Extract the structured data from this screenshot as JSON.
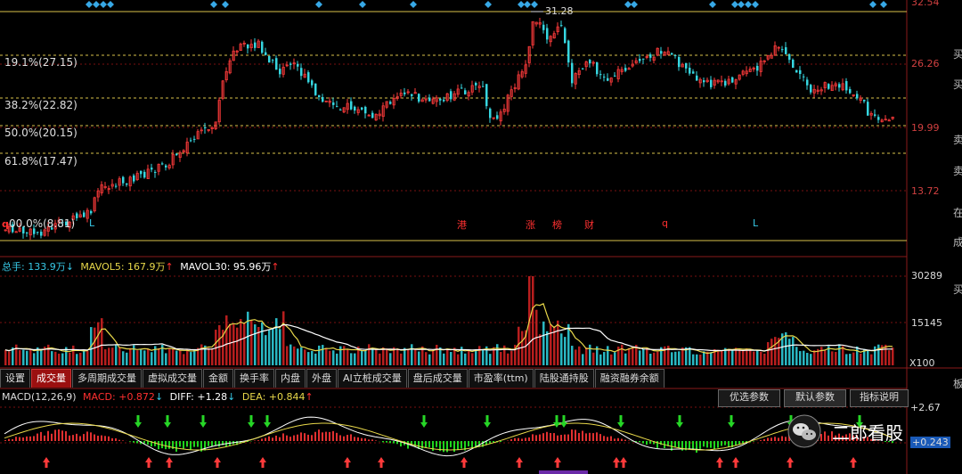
{
  "price_panel": {
    "fib_levels": [
      {
        "label": "19.1%(27.15)"
      },
      {
        "label": "38.2%(22.82)"
      },
      {
        "label": "50.0%(20.15)"
      },
      {
        "label": "61.8%(17.47)"
      },
      {
        "label": "00.0%(8.81)"
      }
    ],
    "y_ticks": [
      "32.54",
      "26.26",
      "19.99",
      "13.72"
    ],
    "high_label": "31.28",
    "left_marker": "q",
    "events": [
      {
        "text": "L",
        "color": "#37c8e6"
      },
      {
        "text": "港",
        "color": "#ff3030"
      },
      {
        "text": "涨",
        "color": "#ff3030"
      },
      {
        "text": "榜",
        "color": "#ff3030"
      },
      {
        "text": "财",
        "color": "#ff3030"
      },
      {
        "text": "q",
        "color": "#ff3030"
      },
      {
        "text": "L",
        "color": "#37c8e6"
      }
    ],
    "right_labels": [
      "买",
      "买",
      "卖",
      "卖",
      "在",
      "成",
      "买",
      "板"
    ]
  },
  "volume_panel": {
    "legend": {
      "total_label": "总手: 133.9万",
      "total_arrow": "↓",
      "ma5_label": "MAVOL5: 167.9万",
      "ma5_arrow": "↑",
      "ma30_label": "MAVOL30: 95.96万",
      "ma30_arrow": "↑"
    },
    "y_ticks": [
      "30289",
      "15145"
    ],
    "unit_label": "X100"
  },
  "tabs": [
    "设置",
    "成交量",
    "多周期成交量",
    "虚拟成交量",
    "金额",
    "换手率",
    "内盘",
    "外盘",
    "AI立桩成交量",
    "盘后成交量",
    "市盈率(ttm)",
    "陆股通持股",
    "融资融券余额"
  ],
  "active_tab": "成交量",
  "macd_panel": {
    "legend": {
      "name": "MACD(12,26,9)",
      "macd_label": "MACD: +0.872",
      "macd_arrow": "↓",
      "diff_label": "DIFF: +1.28",
      "diff_arrow": "↓",
      "dea_label": "DEA: +0.844",
      "dea_arrow": "↑"
    },
    "buttons": [
      "优选参数",
      "默认参数",
      "指标说明"
    ],
    "y_ticks": [
      "+2.67",
      "+0.243"
    ]
  },
  "watermark": {
    "text": "二郎看股",
    "icon": "wechat-icon"
  },
  "colors": {
    "up": "#ff3b3b",
    "down": "#36d6e0",
    "fib_line": "#d8c24a",
    "ma5": "#e8d84a",
    "ma30": "#ffffff",
    "grid_red": "#7a1010",
    "buy_arrow": "#ff3a3a",
    "sell_arrow": "#26d626"
  }
}
